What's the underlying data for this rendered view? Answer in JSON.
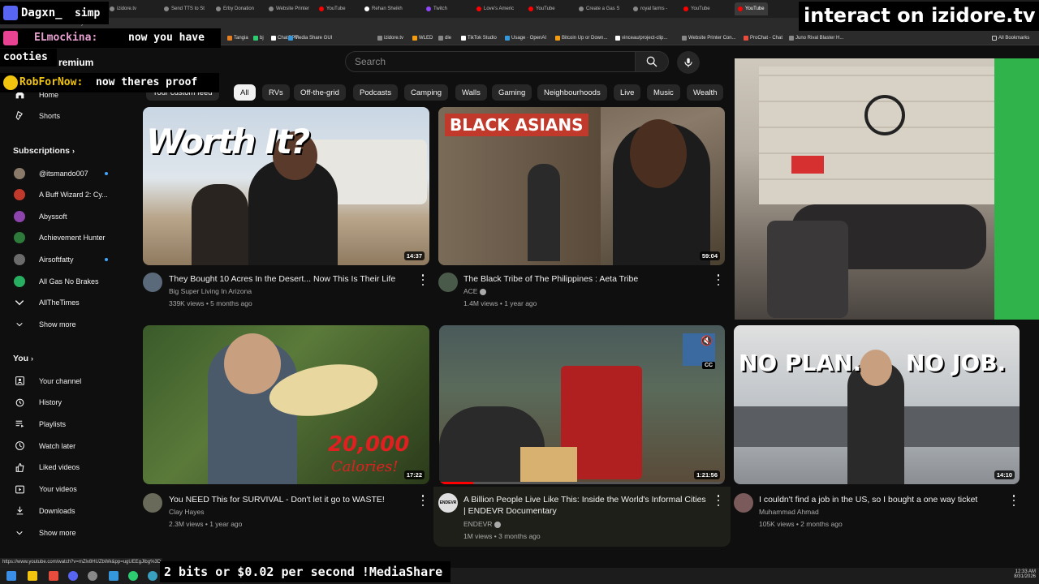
{
  "browser": {
    "tabs": [
      {
        "label": "izidore.tv",
        "color": "#888"
      },
      {
        "label": "Send TTS to St",
        "color": "#888"
      },
      {
        "label": "Erby Donation",
        "color": "#888"
      },
      {
        "label": "Website Printer",
        "color": "#888"
      },
      {
        "label": "YouTube",
        "color": "#ff0000"
      },
      {
        "label": "Rehan Sheikh",
        "color": "#fff"
      },
      {
        "label": "Twitch",
        "color": "#9146ff"
      },
      {
        "label": "Love's Americ",
        "color": "#ff0000"
      },
      {
        "label": "YouTube",
        "color": "#ff0000"
      },
      {
        "label": "Create a Gas S",
        "color": "#888"
      },
      {
        "label": "royal farms -",
        "color": "#888"
      },
      {
        "label": "YouTube",
        "color": "#ff0000"
      },
      {
        "label": "YouTube",
        "color": "#ff0000"
      }
    ],
    "url": "youtube.com",
    "bookmarks": [
      {
        "label": "Tangia",
        "color": "#e67e22"
      },
      {
        "label": "bj",
        "color": "#2ecc71"
      },
      {
        "label": "ChatGPT",
        "color": "#fff"
      },
      {
        "label": "Media Share GUI",
        "color": "#3498db"
      },
      {
        "label": "izidore.tv",
        "color": "#888"
      },
      {
        "label": "WLED",
        "color": "#f39c12"
      },
      {
        "label": "dle",
        "color": "#888"
      },
      {
        "label": "TikTok Studio",
        "color": "#fff"
      },
      {
        "label": "Usage · OpenAI",
        "color": "#3498db"
      },
      {
        "label": "Bitcoin Up or Down...",
        "color": "#f39c12"
      },
      {
        "label": "vinceau/project-clip...",
        "color": "#fff"
      },
      {
        "label": "Website Printer Con...",
        "color": "#888"
      },
      {
        "label": "ProChat - Chat",
        "color": "#e74c3c"
      },
      {
        "label": "Juno Rival Blaster H...",
        "color": "#888"
      }
    ],
    "all_bookmarks": "All Bookmarks",
    "status_url": "https://www.youtube.com/watch?v=mZlv8HUZbWk&pp=ugUEEgJlbg%3D"
  },
  "overlay": {
    "user1": "Dagxn_",
    "msg1": "simp",
    "user2": "ELmockina:",
    "msg2": "now you have",
    "msg2b": "cooties",
    "user3": "RobForNow:",
    "msg3": "now theres proof",
    "premium": "remium",
    "banner": "interact on izidore.tv",
    "media_share": "2 bits or $0.02 per second !MediaShare"
  },
  "search": {
    "placeholder": "Search"
  },
  "sidebar": {
    "home": "Home",
    "shorts": "Shorts",
    "subscriptions_header": "Subscriptions",
    "subscriptions": [
      {
        "label": "@itsmando007",
        "color": "#8a7a6a",
        "dot": true
      },
      {
        "label": "A Buff Wizard 2: Cy...",
        "color": "#c0392b",
        "dot": false
      },
      {
        "label": "Abyssoft",
        "color": "#8e44ad",
        "dot": false
      },
      {
        "label": "Achievement Hunter",
        "color": "#2d7a3a",
        "dot": false
      },
      {
        "label": "Airsoftfatty",
        "color": "#6b6b6b",
        "dot": true
      },
      {
        "label": "All Gas No Brakes",
        "color": "#27ae60",
        "dot": false
      },
      {
        "label": "AllTheTimes",
        "color": "#0f0f0f",
        "dot": false
      }
    ],
    "show_more_1": "Show more",
    "you_header": "You",
    "you_items": [
      {
        "label": "Your channel",
        "icon": "channel-icon"
      },
      {
        "label": "History",
        "icon": "history-icon"
      },
      {
        "label": "Playlists",
        "icon": "playlists-icon"
      },
      {
        "label": "Watch later",
        "icon": "watch-later-icon"
      },
      {
        "label": "Liked videos",
        "icon": "like-icon"
      },
      {
        "label": "Your videos",
        "icon": "your-videos-icon"
      },
      {
        "label": "Downloads",
        "icon": "download-icon"
      }
    ],
    "show_more_2": "Show more"
  },
  "chips": [
    "Your custom feed",
    "All",
    "RVs",
    "Off-the-grid",
    "Podcasts",
    "Camping",
    "Walls",
    "Gaming",
    "Neighbourhoods",
    "Live",
    "Music",
    "Wealth"
  ],
  "videos": [
    {
      "title": "They Bought 10 Acres In the Desert... Now This Is Their Life",
      "title2": "",
      "channel": "Big Super Living In Arizona",
      "meta": "339K views • 5 months ago",
      "duration": "14:37",
      "thumb_text": "Worth It?",
      "avatar": "#5a6a7a"
    },
    {
      "title": "The Black Tribe of The Philippines : Aeta Tribe",
      "title2": "",
      "channel": "ACE",
      "meta": "1.4M views • 1 year ago",
      "duration": "59:04",
      "thumb_text": "BLACK ASIANS",
      "avatar": "#4a5a4a"
    },
    {
      "title": "You NEED This for SURVIVAL - Don't let it go to WASTE!",
      "title2": "",
      "channel": "Clay Hayes",
      "meta": "2.3M views • 1 year ago",
      "duration": "17:22",
      "thumb_text": "20,000",
      "thumb_text2": "Calories!",
      "avatar": "#6a6a5a"
    },
    {
      "title": "A Billion People Live Like This: Inside the World's Informal Cities",
      "title2": "| ENDEVR Documentary",
      "channel": "ENDEVR",
      "meta": "1M views • 3 months ago",
      "duration": "1:21:56",
      "avatar": "#e0e0e0",
      "avatar_text": "ENDEVR"
    },
    {
      "title": "I couldn't find a job in the US, so I bought a one way ticket",
      "title2": "",
      "channel": "Muhammad Ahmad",
      "meta": "105K views • 2 months ago",
      "duration": "14:10",
      "thumb_text": "NO PLAN.",
      "thumb_text2": "NO JOB.",
      "avatar": "#7a5a5a"
    }
  ],
  "taskbar": {
    "time": "12:33 AM",
    "date": "8/31/2026"
  }
}
